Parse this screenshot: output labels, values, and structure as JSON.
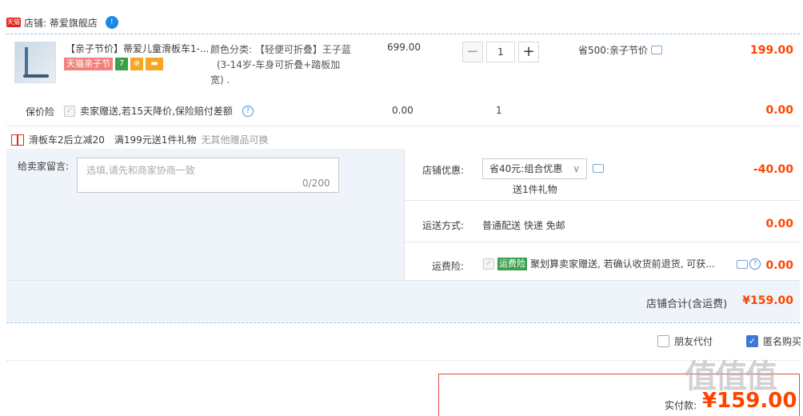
{
  "shop": {
    "badge": "天猫",
    "name": "店铺: 蒂爱旗舰店",
    "ww": "!"
  },
  "product": {
    "title": "【亲子节价】蒂爱儿童滑板车1-...",
    "tag_promo": "天猫亲子节",
    "tag1": "7",
    "sku_line1": "颜色分类: 【轻便可折叠】王子蓝",
    "sku_line2": "(3-14岁-车身可折叠+踏板加",
    "sku_line3": "宽) .",
    "unit_price": "699.00",
    "qty": "1",
    "minus": "−",
    "plus": "+",
    "save": "省500:亲子节价",
    "total": "199.00"
  },
  "insurance": {
    "label": "保价险",
    "text": "卖家赠送,若15天降价,保险赔付差额",
    "q": "?",
    "price": "0.00",
    "qty": "1",
    "total": "0.00"
  },
  "promo": {
    "text1": "滑板车2后立减20",
    "text2": "满199元送1件礼物",
    "text3": "无其他赠品可换"
  },
  "memo": {
    "label": "给卖家留言:",
    "placeholder": "选填,请先和商家协商一致",
    "count": "0/200"
  },
  "shop_discount": {
    "label": "店铺优惠:",
    "selected": "省40元:组合优惠",
    "chev": "∨",
    "gift": "送1件礼物",
    "amount": "-40.00"
  },
  "shipping": {
    "label": "运送方式:",
    "value": "普通配送 快递 免邮",
    "amount": "0.00"
  },
  "freight_ins": {
    "label": "运费险:",
    "tag": "运费险",
    "text": "聚划算卖家赠送, 若确认收货前退货, 可获...",
    "q": "?",
    "amount": "0.00"
  },
  "subtotal": {
    "label": "店铺合计(含运费)",
    "value": "¥159.00"
  },
  "options": {
    "friend_pay": "朋友代付",
    "anon": "匿名购买",
    "check": "✓"
  },
  "final": {
    "label": "实付款:",
    "value": "¥159.00"
  },
  "watermark": "值值值"
}
